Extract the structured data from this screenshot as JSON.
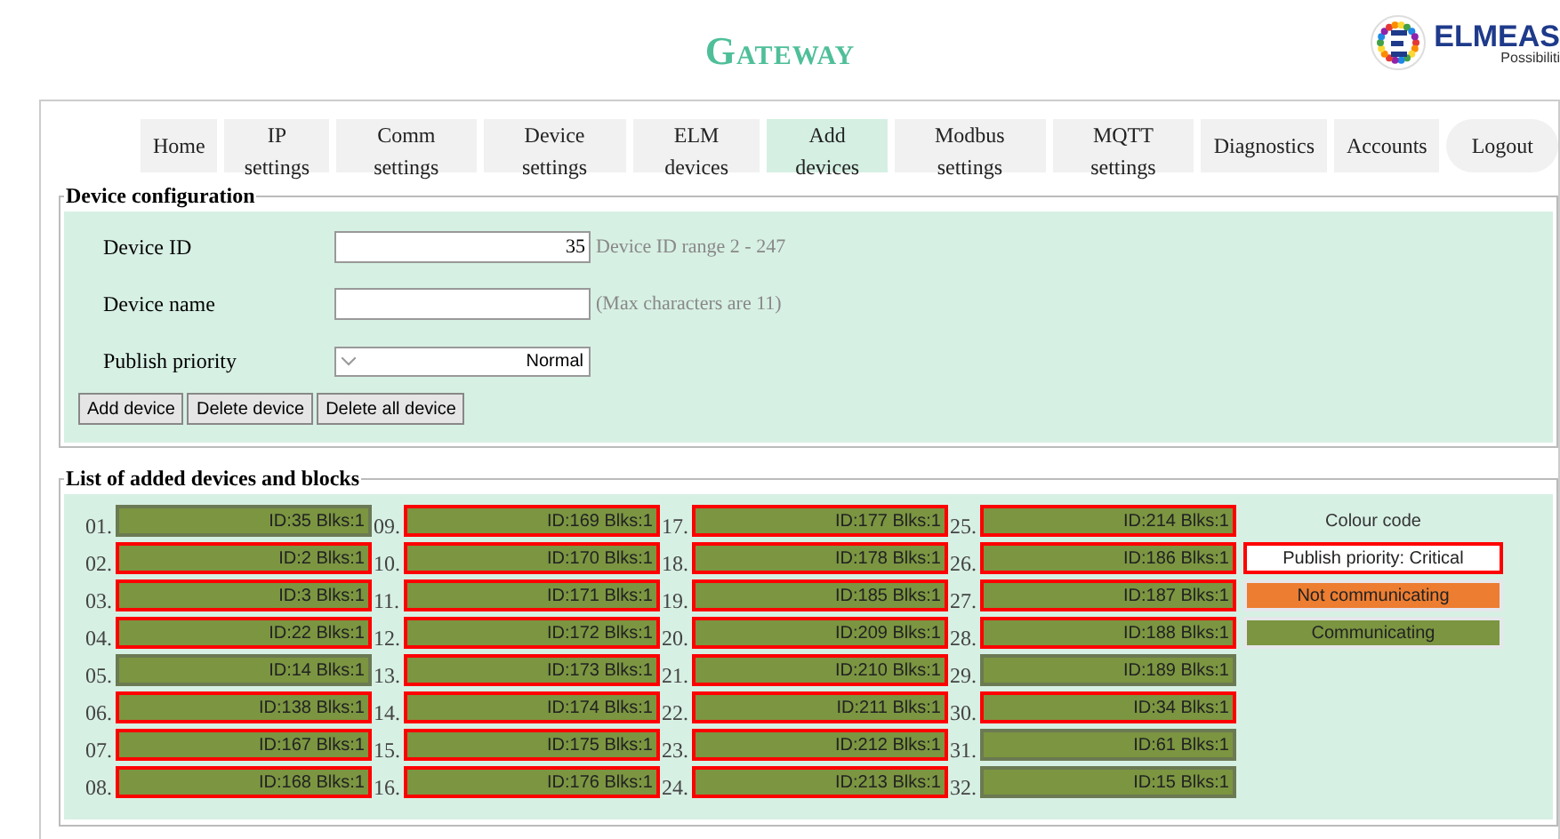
{
  "header": {
    "title": "Gateway",
    "logo_name": "ELMEAS",
    "logo_tagline": "Possibiliti"
  },
  "tabs": [
    {
      "label": "Home",
      "selected": false
    },
    {
      "label": "IP settings",
      "selected": false
    },
    {
      "label": "Comm settings",
      "selected": false
    },
    {
      "label": "Device settings",
      "selected": false
    },
    {
      "label": "ELM devices",
      "selected": false
    },
    {
      "label": "Add devices",
      "selected": true
    },
    {
      "label": "Modbus settings",
      "selected": false
    },
    {
      "label": "MQTT settings",
      "selected": false
    },
    {
      "label": "Diagnostics",
      "selected": false
    },
    {
      "label": "Accounts",
      "selected": false
    },
    {
      "label": "Logout",
      "selected": false
    }
  ],
  "device_configuration": {
    "legend": "Device configuration",
    "fields": [
      {
        "kind": "text",
        "label": "Device ID",
        "value": "35",
        "hint": "Device ID range 2 - 247"
      },
      {
        "kind": "text",
        "label": "Device name",
        "hint": "(Max characters are 11)"
      },
      {
        "kind": "select",
        "label": "Publish priority",
        "value": "Normal"
      }
    ],
    "buttons": [
      "Add device",
      "Delete device",
      "Delete all device"
    ]
  },
  "device_list": {
    "legend": "List of added devices and blocks",
    "devices": [
      {
        "number": "01.",
        "text": "ID:35 Blks:1",
        "critical": false,
        "communicating": true
      },
      {
        "number": "02.",
        "text": "ID:2 Blks:1",
        "critical": true,
        "communicating": true
      },
      {
        "number": "03.",
        "text": "ID:3 Blks:1",
        "critical": true,
        "communicating": true
      },
      {
        "number": "04.",
        "text": "ID:22 Blks:1",
        "critical": true,
        "communicating": true
      },
      {
        "number": "05.",
        "text": "ID:14 Blks:1",
        "critical": false,
        "communicating": true
      },
      {
        "number": "06.",
        "text": "ID:138 Blks:1",
        "critical": true,
        "communicating": true
      },
      {
        "number": "07.",
        "text": "ID:167 Blks:1",
        "critical": true,
        "communicating": true
      },
      {
        "number": "08.",
        "text": "ID:168 Blks:1",
        "critical": true,
        "communicating": true
      },
      {
        "number": "09.",
        "text": "ID:169 Blks:1",
        "critical": true,
        "communicating": true
      },
      {
        "number": "10.",
        "text": "ID:170 Blks:1",
        "critical": true,
        "communicating": true
      },
      {
        "number": "11.",
        "text": "ID:171 Blks:1",
        "critical": true,
        "communicating": true
      },
      {
        "number": "12.",
        "text": "ID:172 Blks:1",
        "critical": true,
        "communicating": true
      },
      {
        "number": "13.",
        "text": "ID:173 Blks:1",
        "critical": true,
        "communicating": true
      },
      {
        "number": "14.",
        "text": "ID:174 Blks:1",
        "critical": true,
        "communicating": true
      },
      {
        "number": "15.",
        "text": "ID:175 Blks:1",
        "critical": true,
        "communicating": true
      },
      {
        "number": "16.",
        "text": "ID:176 Blks:1",
        "critical": true,
        "communicating": true
      },
      {
        "number": "17.",
        "text": "ID:177 Blks:1",
        "critical": true,
        "communicating": true
      },
      {
        "number": "18.",
        "text": "ID:178 Blks:1",
        "critical": true,
        "communicating": true
      },
      {
        "number": "19.",
        "text": "ID:185 Blks:1",
        "critical": true,
        "communicating": true
      },
      {
        "number": "20.",
        "text": "ID:209 Blks:1",
        "critical": true,
        "communicating": true
      },
      {
        "number": "21.",
        "text": "ID:210 Blks:1",
        "critical": true,
        "communicating": true
      },
      {
        "number": "22.",
        "text": "ID:211 Blks:1",
        "critical": true,
        "communicating": true
      },
      {
        "number": "23.",
        "text": "ID:212 Blks:1",
        "critical": true,
        "communicating": true
      },
      {
        "number": "24.",
        "text": "ID:213 Blks:1",
        "critical": true,
        "communicating": true
      },
      {
        "number": "25.",
        "text": "ID:214 Blks:1",
        "critical": true,
        "communicating": true
      },
      {
        "number": "26.",
        "text": "ID:186 Blks:1",
        "critical": true,
        "communicating": true
      },
      {
        "number": "27.",
        "text": "ID:187 Blks:1",
        "critical": true,
        "communicating": true
      },
      {
        "number": "28.",
        "text": "ID:188 Blks:1",
        "critical": true,
        "communicating": true
      },
      {
        "number": "29.",
        "text": "ID:189 Blks:1",
        "critical": false,
        "communicating": true
      },
      {
        "number": "30.",
        "text": "ID:34 Blks:1",
        "critical": true,
        "communicating": true
      },
      {
        "number": "31.",
        "text": "ID:61 Blks:1",
        "critical": false,
        "communicating": true
      },
      {
        "number": "32.",
        "text": "ID:15 Blks:1",
        "critical": false,
        "communicating": true
      }
    ],
    "colour_code": {
      "title": "Colour code",
      "items": [
        {
          "kind": "critical",
          "label": "Publish priority: Critical"
        },
        {
          "kind": "not_communicating",
          "label": "Not communicating"
        },
        {
          "kind": "communicating",
          "label": "Communicating"
        }
      ]
    }
  }
}
